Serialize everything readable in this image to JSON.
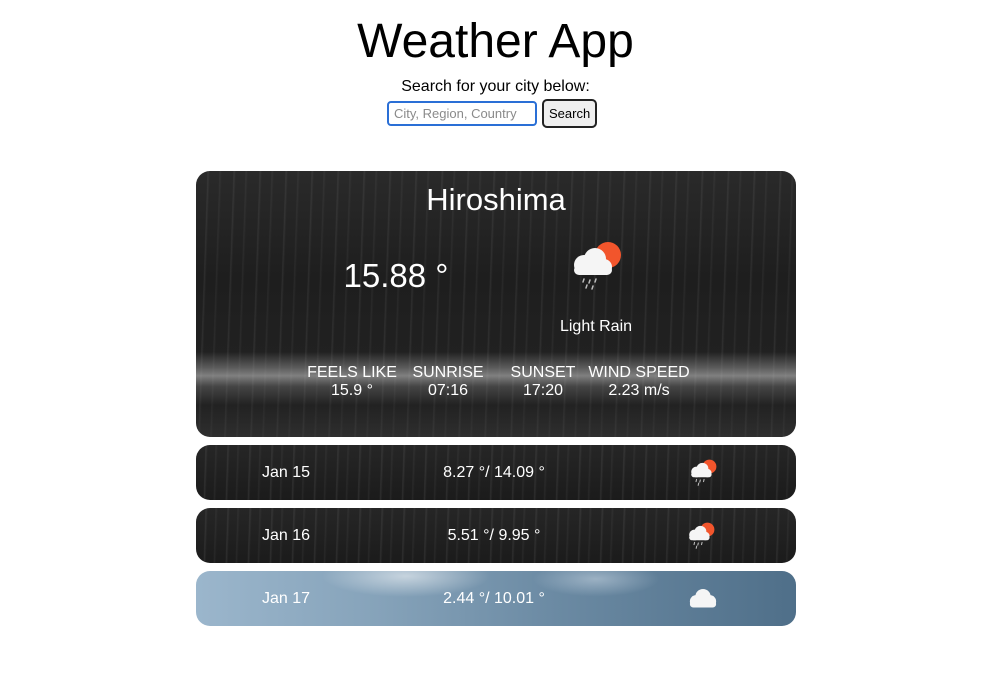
{
  "header": {
    "title": "Weather App",
    "search_prompt": "Search for your city below:",
    "search_placeholder": "City, Region, Country",
    "search_value": "",
    "search_button_label": "Search"
  },
  "current": {
    "city": "Hiroshima",
    "temperature": "15.88 °",
    "condition": "Light Rain",
    "icon": "light-rain-partly-cloudy-icon",
    "stats": [
      {
        "label": "FEELS LIKE",
        "value": "15.9 °"
      },
      {
        "label": "SUNRISE",
        "value": "07:16"
      },
      {
        "label": "SUNSET",
        "value": "17:20"
      },
      {
        "label": "WIND SPEED",
        "value": "2.23 m/s"
      }
    ]
  },
  "forecast": [
    {
      "date": "Jan 15",
      "temps": "8.27 °/ 14.09 °",
      "icon": "light-rain-partly-cloudy-icon",
      "background": "rain"
    },
    {
      "date": "Jan 16",
      "temps": "5.51 °/ 9.95 °",
      "icon": "light-rain-partly-cloudy-icon",
      "background": "rain"
    },
    {
      "date": "Jan 17",
      "temps": "2.44 °/ 10.01 °",
      "icon": "cloud-icon",
      "background": "clouds"
    }
  ],
  "colors": {
    "sun": "#f2552c",
    "cloud": "#f5f5f5",
    "input_focus_border": "#2a6fd6"
  }
}
